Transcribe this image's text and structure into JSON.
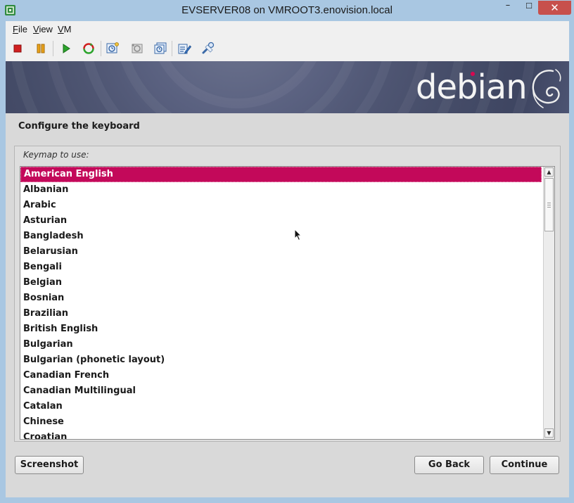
{
  "window": {
    "title": "EVSERVER08 on VMROOT3.enovision.local",
    "minimize_glyph": "–",
    "maximize_glyph": "☐",
    "close_glyph": "✕"
  },
  "menu": {
    "items": [
      {
        "underline": "F",
        "rest": "ile"
      },
      {
        "underline": "V",
        "rest": "iew"
      },
      {
        "underline": "V",
        "rest": "M"
      }
    ]
  },
  "toolbar": {
    "icons": [
      "stop-icon",
      "pause-icon",
      "play-icon",
      "reset-icon",
      "snapshot-icon",
      "revert-snapshot-icon",
      "manage-snapshots-icon",
      "edit-settings-icon",
      "vm-tools-icon"
    ]
  },
  "guest": {
    "brand": "debian",
    "page_title": "Configure the keyboard",
    "panel_label": "Keymap to use:",
    "keymaps": [
      "American English",
      "Albanian",
      "Arabic",
      "Asturian",
      "Bangladesh",
      "Belarusian",
      "Bengali",
      "Belgian",
      "Bosnian",
      "Brazilian",
      "British English",
      "Bulgarian",
      "Bulgarian (phonetic layout)",
      "Canadian French",
      "Canadian Multilingual",
      "Catalan",
      "Chinese",
      "Croatian"
    ],
    "selected_index": 0,
    "buttons": {
      "screenshot": "Screenshot",
      "go_back": "Go Back",
      "continue": "Continue"
    }
  },
  "colors": {
    "selection": "#c3095a",
    "debian_red": "#d70751",
    "frame": "#a9c7e2",
    "close_button": "#c7504c"
  }
}
